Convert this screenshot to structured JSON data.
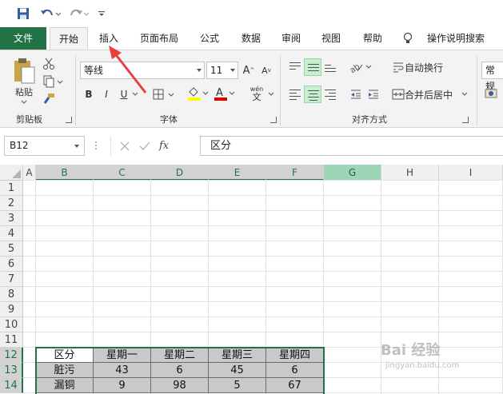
{
  "accent_color": "#217346",
  "annotation_color": "#e8413b",
  "tabs": {
    "file": "文件",
    "home": "开始",
    "insert": "插入",
    "page_layout": "页面布局",
    "formulas": "公式",
    "data": "数据",
    "review": "审阅",
    "view": "视图",
    "help": "帮助",
    "tell_me": "操作说明搜索"
  },
  "ribbon": {
    "clipboard": {
      "paste": "粘贴",
      "group": "剪贴板"
    },
    "font": {
      "name": "等线",
      "size": "11",
      "bold": "B",
      "italic": "I",
      "underline": "U",
      "group": "字体",
      "wen": "wén",
      "wen2": "文"
    },
    "alignment": {
      "wrap": "自动换行",
      "merge": "合并后居中",
      "group": "对齐方式"
    },
    "number": {
      "format": "常规"
    }
  },
  "formula_bar": {
    "name_box": "B12",
    "fx": "fx",
    "content": "区分"
  },
  "columns": [
    "A",
    "B",
    "C",
    "D",
    "E",
    "F",
    "G",
    "H",
    "I"
  ],
  "rows": [
    "1",
    "2",
    "3",
    "4",
    "5",
    "6",
    "7",
    "8",
    "9",
    "10",
    "11",
    "12",
    "13",
    "14"
  ],
  "table": {
    "headers": [
      "区分",
      "星期一",
      "星期二",
      "星期三",
      "星期四"
    ],
    "rows": [
      [
        "脏污",
        "43",
        "6",
        "45",
        "6"
      ],
      [
        "漏铜",
        "9",
        "98",
        "5",
        "67"
      ]
    ]
  },
  "watermark": {
    "text": "Bai 经验",
    "sub": "jingyan.baidu.com"
  }
}
